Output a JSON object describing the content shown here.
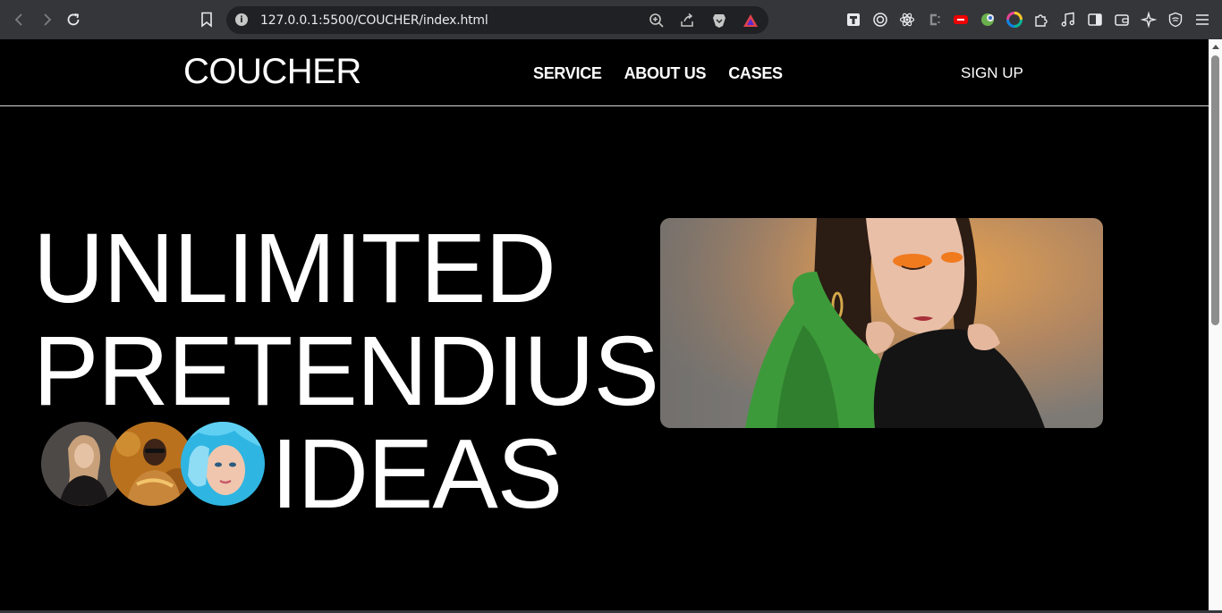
{
  "browser": {
    "url": "127.0.0.1:5500/COUCHER/index.html",
    "info_icon_glyph": "i"
  },
  "header": {
    "logo": "COUCHER",
    "nav": [
      "SERVICE",
      "ABOUT US",
      "CASES"
    ],
    "signup": "SIGN UP"
  },
  "hero": {
    "line1": "UNLIMITED",
    "line2": "PRETENDIUS",
    "line3": "IDEAS",
    "avatars": [
      "avatar-woman-dark-outfit",
      "avatar-woman-gold-glitter",
      "avatar-woman-blue-paper"
    ],
    "image": "woman-orange-eyeshadow-green-scarf"
  },
  "colors": {
    "page_bg": "#000000",
    "text": "#ffffff",
    "chrome_bg": "#35363a",
    "omnibox_bg": "#202124"
  }
}
